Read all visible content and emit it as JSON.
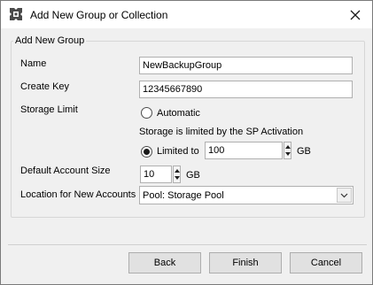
{
  "window": {
    "title": "Add New Group or Collection",
    "icons": {
      "app": "gear-app-icon",
      "close": "close-icon"
    }
  },
  "group": {
    "legend": "Add New Group",
    "name_label": "Name",
    "name_value": "NewBackupGroup",
    "create_key_label": "Create Key",
    "create_key_value": "12345667890",
    "storage_limit_label": "Storage Limit",
    "automatic_label": "Automatic",
    "automatic_checked": false,
    "storage_note": "Storage is limited by the SP Activation",
    "limited_to_label": "Limited to",
    "limited_to_checked": true,
    "limited_to_value": "100",
    "limited_to_unit": "GB",
    "default_account_size_label": "Default Account Size",
    "default_account_size_value": "10",
    "default_account_size_unit": "GB",
    "location_label": "Location for New Accounts",
    "location_value": "Pool: Storage Pool"
  },
  "footer": {
    "back_label": "Back",
    "finish_label": "Finish",
    "cancel_label": "Cancel"
  }
}
